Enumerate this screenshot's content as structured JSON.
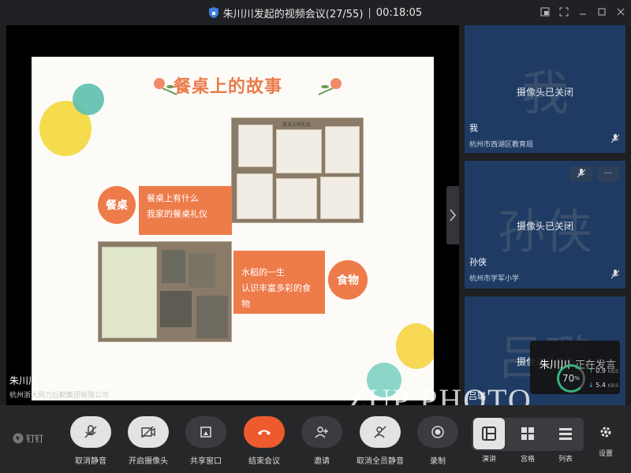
{
  "window": {
    "title": "朱川川发起的视频会议(27/55)",
    "elapsed": "00:18:05",
    "separator": "|"
  },
  "slide": {
    "title": "餐桌上的故事",
    "tag_left": "餐桌",
    "tag_right": "食物",
    "block1_line1": "餐桌上有什么",
    "block1_line2": "我家的餐桌礼仪",
    "block2_line1": "水稻的一生",
    "block2_line2": "认识丰富多彩的食物",
    "photo_caption": "舌尖上的礼仪"
  },
  "presenter": {
    "name": "朱川川",
    "org": "杭州浙大同力后勤集团有限公司"
  },
  "tiles": [
    {
      "big": "我",
      "status": "摄像头已关闭",
      "name": "我",
      "org": "杭州市西湖区教育局"
    },
    {
      "big": "孙侠",
      "status": "摄像头已关闭",
      "name": "孙侠",
      "org": "杭州市学军小学"
    },
    {
      "big": "吕璐",
      "status": "摄像头已关闭",
      "name": "吕璐",
      "org": ""
    }
  ],
  "tile_controls": {
    "more": "···"
  },
  "speaking": {
    "name": "朱川川",
    "status": "正在发言",
    "quality": "70",
    "quality_unit": "%",
    "up": "0.9",
    "up_unit": "KB/S",
    "down": "5.4",
    "down_unit": "KB/S"
  },
  "watermark": "ZUP PHOTO",
  "brand": "钉钉",
  "toolbar": {
    "mute": "取消静音",
    "camera": "开启摄像头",
    "share": "共享窗口",
    "end": "结束会议",
    "invite": "邀请",
    "unmute_all": "取消全员静音",
    "record": "录制"
  },
  "layouts": {
    "speech": "演讲",
    "grid": "宫格",
    "list": "列表"
  },
  "settings": "设置",
  "colors": {
    "accent_orange": "#ee7b4a",
    "end_red": "#ec5a2e",
    "tile_blue": "#1f3b63"
  }
}
